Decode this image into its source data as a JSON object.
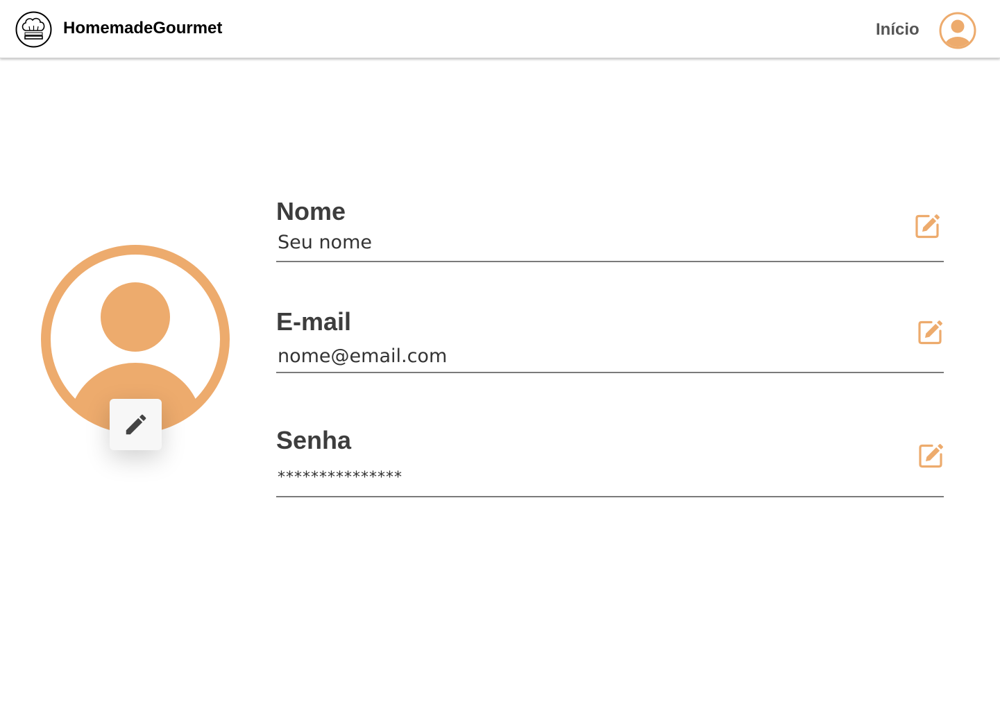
{
  "header": {
    "brand": "HomemadeGourmet",
    "logo_text": "HomemadeGourmet",
    "nav_link": "Início"
  },
  "profile": {
    "fields": [
      {
        "label": "Nome",
        "value": "Seu nome"
      },
      {
        "label": "E-mail",
        "value": "nome@email.com"
      },
      {
        "label": "Senha",
        "value": "***************"
      }
    ]
  },
  "colors": {
    "accent": "#EDAB6D",
    "text_dark": "#3D3D3D",
    "pencil": "#444444"
  },
  "icons": {
    "logo": "chef-hat-logo-icon",
    "nav_avatar": "user-avatar-icon",
    "profile_photo": "user-avatar-icon",
    "edit_photo": "pencil-icon",
    "edit_field": "edit-square-icon"
  }
}
